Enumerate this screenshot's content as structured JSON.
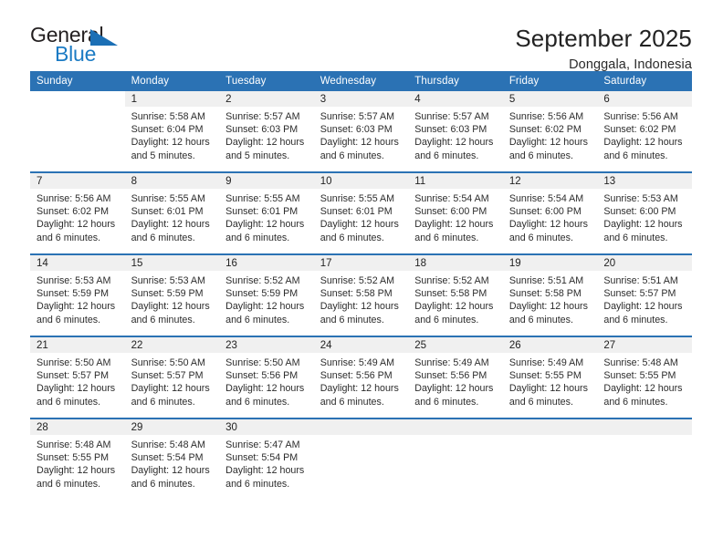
{
  "brand": {
    "name_part1": "General",
    "name_part2": "Blue",
    "mark_icon": "blue-triangle-flag-icon",
    "accent_color": "#1b7bc4"
  },
  "header": {
    "title": "September 2025",
    "subtitle": "Donggala, Indonesia"
  },
  "theme": {
    "header_band": "#2b72b4",
    "row_divider": "#2b72b4",
    "daynum_background": "#f0f0f0",
    "text": "#222222"
  },
  "calendar": {
    "weekday_headers": [
      "Sunday",
      "Monday",
      "Tuesday",
      "Wednesday",
      "Thursday",
      "Friday",
      "Saturday"
    ],
    "weeks": [
      [
        {
          "day": "",
          "sunrise": "",
          "sunset": "",
          "daylight1": "",
          "daylight2": "",
          "blank": true
        },
        {
          "day": "1",
          "sunrise": "Sunrise: 5:58 AM",
          "sunset": "Sunset: 6:04 PM",
          "daylight1": "Daylight: 12 hours",
          "daylight2": "and 5 minutes."
        },
        {
          "day": "2",
          "sunrise": "Sunrise: 5:57 AM",
          "sunset": "Sunset: 6:03 PM",
          "daylight1": "Daylight: 12 hours",
          "daylight2": "and 5 minutes."
        },
        {
          "day": "3",
          "sunrise": "Sunrise: 5:57 AM",
          "sunset": "Sunset: 6:03 PM",
          "daylight1": "Daylight: 12 hours",
          "daylight2": "and 6 minutes."
        },
        {
          "day": "4",
          "sunrise": "Sunrise: 5:57 AM",
          "sunset": "Sunset: 6:03 PM",
          "daylight1": "Daylight: 12 hours",
          "daylight2": "and 6 minutes."
        },
        {
          "day": "5",
          "sunrise": "Sunrise: 5:56 AM",
          "sunset": "Sunset: 6:02 PM",
          "daylight1": "Daylight: 12 hours",
          "daylight2": "and 6 minutes."
        },
        {
          "day": "6",
          "sunrise": "Sunrise: 5:56 AM",
          "sunset": "Sunset: 6:02 PM",
          "daylight1": "Daylight: 12 hours",
          "daylight2": "and 6 minutes."
        }
      ],
      [
        {
          "day": "7",
          "sunrise": "Sunrise: 5:56 AM",
          "sunset": "Sunset: 6:02 PM",
          "daylight1": "Daylight: 12 hours",
          "daylight2": "and 6 minutes."
        },
        {
          "day": "8",
          "sunrise": "Sunrise: 5:55 AM",
          "sunset": "Sunset: 6:01 PM",
          "daylight1": "Daylight: 12 hours",
          "daylight2": "and 6 minutes."
        },
        {
          "day": "9",
          "sunrise": "Sunrise: 5:55 AM",
          "sunset": "Sunset: 6:01 PM",
          "daylight1": "Daylight: 12 hours",
          "daylight2": "and 6 minutes."
        },
        {
          "day": "10",
          "sunrise": "Sunrise: 5:55 AM",
          "sunset": "Sunset: 6:01 PM",
          "daylight1": "Daylight: 12 hours",
          "daylight2": "and 6 minutes."
        },
        {
          "day": "11",
          "sunrise": "Sunrise: 5:54 AM",
          "sunset": "Sunset: 6:00 PM",
          "daylight1": "Daylight: 12 hours",
          "daylight2": "and 6 minutes."
        },
        {
          "day": "12",
          "sunrise": "Sunrise: 5:54 AM",
          "sunset": "Sunset: 6:00 PM",
          "daylight1": "Daylight: 12 hours",
          "daylight2": "and 6 minutes."
        },
        {
          "day": "13",
          "sunrise": "Sunrise: 5:53 AM",
          "sunset": "Sunset: 6:00 PM",
          "daylight1": "Daylight: 12 hours",
          "daylight2": "and 6 minutes."
        }
      ],
      [
        {
          "day": "14",
          "sunrise": "Sunrise: 5:53 AM",
          "sunset": "Sunset: 5:59 PM",
          "daylight1": "Daylight: 12 hours",
          "daylight2": "and 6 minutes."
        },
        {
          "day": "15",
          "sunrise": "Sunrise: 5:53 AM",
          "sunset": "Sunset: 5:59 PM",
          "daylight1": "Daylight: 12 hours",
          "daylight2": "and 6 minutes."
        },
        {
          "day": "16",
          "sunrise": "Sunrise: 5:52 AM",
          "sunset": "Sunset: 5:59 PM",
          "daylight1": "Daylight: 12 hours",
          "daylight2": "and 6 minutes."
        },
        {
          "day": "17",
          "sunrise": "Sunrise: 5:52 AM",
          "sunset": "Sunset: 5:58 PM",
          "daylight1": "Daylight: 12 hours",
          "daylight2": "and 6 minutes."
        },
        {
          "day": "18",
          "sunrise": "Sunrise: 5:52 AM",
          "sunset": "Sunset: 5:58 PM",
          "daylight1": "Daylight: 12 hours",
          "daylight2": "and 6 minutes."
        },
        {
          "day": "19",
          "sunrise": "Sunrise: 5:51 AM",
          "sunset": "Sunset: 5:58 PM",
          "daylight1": "Daylight: 12 hours",
          "daylight2": "and 6 minutes."
        },
        {
          "day": "20",
          "sunrise": "Sunrise: 5:51 AM",
          "sunset": "Sunset: 5:57 PM",
          "daylight1": "Daylight: 12 hours",
          "daylight2": "and 6 minutes."
        }
      ],
      [
        {
          "day": "21",
          "sunrise": "Sunrise: 5:50 AM",
          "sunset": "Sunset: 5:57 PM",
          "daylight1": "Daylight: 12 hours",
          "daylight2": "and 6 minutes."
        },
        {
          "day": "22",
          "sunrise": "Sunrise: 5:50 AM",
          "sunset": "Sunset: 5:57 PM",
          "daylight1": "Daylight: 12 hours",
          "daylight2": "and 6 minutes."
        },
        {
          "day": "23",
          "sunrise": "Sunrise: 5:50 AM",
          "sunset": "Sunset: 5:56 PM",
          "daylight1": "Daylight: 12 hours",
          "daylight2": "and 6 minutes."
        },
        {
          "day": "24",
          "sunrise": "Sunrise: 5:49 AM",
          "sunset": "Sunset: 5:56 PM",
          "daylight1": "Daylight: 12 hours",
          "daylight2": "and 6 minutes."
        },
        {
          "day": "25",
          "sunrise": "Sunrise: 5:49 AM",
          "sunset": "Sunset: 5:56 PM",
          "daylight1": "Daylight: 12 hours",
          "daylight2": "and 6 minutes."
        },
        {
          "day": "26",
          "sunrise": "Sunrise: 5:49 AM",
          "sunset": "Sunset: 5:55 PM",
          "daylight1": "Daylight: 12 hours",
          "daylight2": "and 6 minutes."
        },
        {
          "day": "27",
          "sunrise": "Sunrise: 5:48 AM",
          "sunset": "Sunset: 5:55 PM",
          "daylight1": "Daylight: 12 hours",
          "daylight2": "and 6 minutes."
        }
      ],
      [
        {
          "day": "28",
          "sunrise": "Sunrise: 5:48 AM",
          "sunset": "Sunset: 5:55 PM",
          "daylight1": "Daylight: 12 hours",
          "daylight2": "and 6 minutes."
        },
        {
          "day": "29",
          "sunrise": "Sunrise: 5:48 AM",
          "sunset": "Sunset: 5:54 PM",
          "daylight1": "Daylight: 12 hours",
          "daylight2": "and 6 minutes."
        },
        {
          "day": "30",
          "sunrise": "Sunrise: 5:47 AM",
          "sunset": "Sunset: 5:54 PM",
          "daylight1": "Daylight: 12 hours",
          "daylight2": "and 6 minutes."
        },
        {
          "day": "",
          "sunrise": "",
          "sunset": "",
          "daylight1": "",
          "daylight2": "",
          "empty": true
        },
        {
          "day": "",
          "sunrise": "",
          "sunset": "",
          "daylight1": "",
          "daylight2": "",
          "empty": true
        },
        {
          "day": "",
          "sunrise": "",
          "sunset": "",
          "daylight1": "",
          "daylight2": "",
          "empty": true
        },
        {
          "day": "",
          "sunrise": "",
          "sunset": "",
          "daylight1": "",
          "daylight2": "",
          "empty": true
        }
      ]
    ]
  }
}
